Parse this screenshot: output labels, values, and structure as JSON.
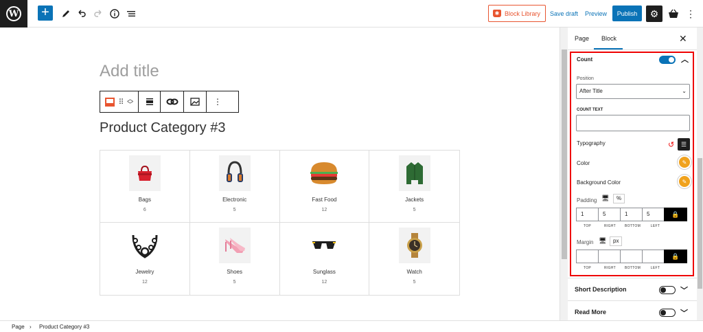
{
  "topbar": {
    "block_library_label": "Block Library",
    "save_draft_label": "Save draft",
    "preview_label": "Preview",
    "publish_label": "Publish"
  },
  "editor": {
    "title_placeholder": "Add title",
    "block_title": "Product Category #3"
  },
  "categories": [
    {
      "name": "Bags",
      "count": "6",
      "icon": "handbag"
    },
    {
      "name": "Electronic",
      "count": "5",
      "icon": "headphones"
    },
    {
      "name": "Fast Food",
      "count": "12",
      "icon": "burger"
    },
    {
      "name": "Jackets",
      "count": "5",
      "icon": "jacket"
    },
    {
      "name": "Jewelry",
      "count": "12",
      "icon": "necklace"
    },
    {
      "name": "Shoes",
      "count": "5",
      "icon": "high-heel"
    },
    {
      "name": "Sunglass",
      "count": "12",
      "icon": "sunglasses"
    },
    {
      "name": "Watch",
      "count": "5",
      "icon": "wristwatch"
    }
  ],
  "sidebar": {
    "tab_page": "Page",
    "tab_block": "Block",
    "count_label": "Count",
    "position_label": "Position",
    "position_value": "After Title",
    "count_text_label": "COUNT TEXT",
    "typography_label": "Typography",
    "color_label": "Color",
    "bg_color_label": "Background Color",
    "padding_label": "Padding",
    "padding_unit": "%",
    "padding_values": [
      "1",
      "5",
      "1",
      "5"
    ],
    "dim_labels": [
      "TOP",
      "RIGHT",
      "BOTTOM",
      "LEFT"
    ],
    "margin_label": "Margin",
    "margin_unit": "px",
    "short_description_label": "Short Description",
    "read_more_label": "Read More",
    "accent_color": "#0a73b7",
    "highlight_color": "#e00000",
    "swatch_color": "#f0a21d"
  },
  "footer": {
    "crumb_1": "Page",
    "crumb_2": "Product Category #3"
  }
}
